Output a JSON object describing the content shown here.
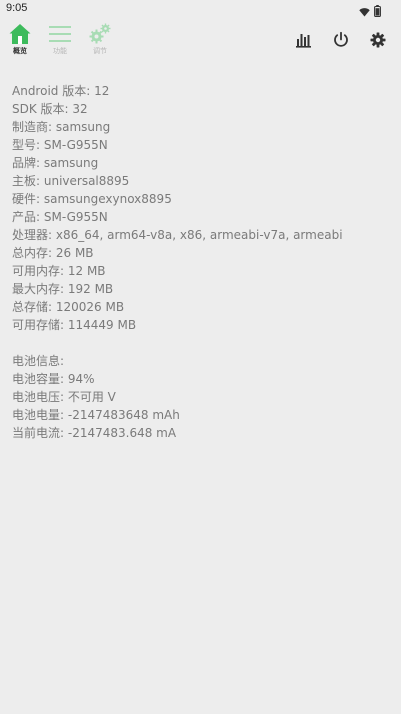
{
  "status_bar": {
    "time": "9:05",
    "icons": [
      "wifi-icon",
      "battery-icon"
    ]
  },
  "toolbar": {
    "tabs": [
      {
        "label": "概览",
        "icon": "home-icon",
        "active": true
      },
      {
        "label": "功能",
        "icon": "menu-icon",
        "active": false
      },
      {
        "label": "调节",
        "icon": "gears-icon",
        "active": false
      }
    ],
    "actions": [
      {
        "icon": "bar-chart-icon"
      },
      {
        "icon": "power-icon"
      },
      {
        "icon": "settings-icon"
      }
    ]
  },
  "colors": {
    "accent_green": "#3dbb5c",
    "inactive_green": "#a8dcb4",
    "background": "#ededed",
    "text": "#7a7a7a"
  },
  "device_info": [
    "Android 版本: 12",
    "SDK 版本: 32",
    "制造商: samsung",
    "型号: SM-G955N",
    "品牌: samsung",
    "主板: universal8895",
    "硬件: samsungexynox8895",
    "产品: SM-G955N",
    "处理器: x86_64, arm64-v8a, x86, armeabi-v7a, armeabi",
    "总内存: 26 MB",
    "可用内存: 12 MB",
    "最大内存: 192 MB",
    "总存储: 120026 MB",
    "可用存储: 114449 MB"
  ],
  "battery_info": [
    "电池信息:",
    "电池容量: 94%",
    "电池电压: 不可用 V",
    "电池电量: -2147483648 mAh",
    "当前电流: -2147483.648 mA"
  ]
}
